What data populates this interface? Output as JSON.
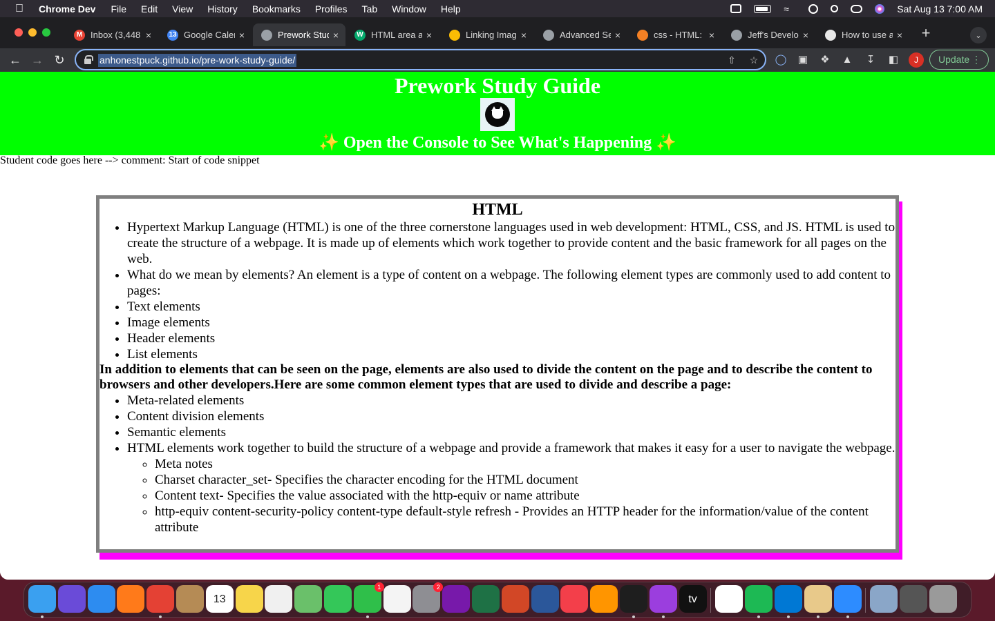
{
  "menubar": {
    "app_name": "Chrome Dev",
    "items": [
      "File",
      "Edit",
      "View",
      "History",
      "Bookmarks",
      "Profiles",
      "Tab",
      "Window",
      "Help"
    ],
    "datetime": "Sat Aug 13  7:00 AM"
  },
  "tabs": [
    {
      "title": "Inbox (3,448",
      "favicon": "gmail-icon",
      "fav_char": "M",
      "fav_color": "#ea4335"
    },
    {
      "title": "Google Caler",
      "favicon": "calendar-icon",
      "fav_char": "13",
      "fav_color": "#4285f4"
    },
    {
      "title": "Prework Stud",
      "favicon": "globe-icon",
      "fav_char": "",
      "fav_color": "#9aa0a6",
      "active": true
    },
    {
      "title": "HTML area a",
      "favicon": "w3-icon",
      "fav_char": "W",
      "fav_color": "#04aa6d"
    },
    {
      "title": "Linking Imag",
      "favicon": "drive-icon",
      "fav_char": "",
      "fav_color": "#fbbc04"
    },
    {
      "title": "Advanced Se",
      "favicon": "globe-icon",
      "fav_char": "",
      "fav_color": "#9aa0a6"
    },
    {
      "title": "css - HTML:",
      "favicon": "stackoverflow-icon",
      "fav_char": "",
      "fav_color": "#f48024"
    },
    {
      "title": "Jeff's Develo",
      "favicon": "globe-icon",
      "fav_char": "",
      "fav_color": "#9aa0a6"
    },
    {
      "title": "How to use a",
      "favicon": "openai-icon",
      "fav_char": "",
      "fav_color": "#e8e8e8"
    }
  ],
  "toolbar": {
    "url": "anhonestpuck.github.io/pre-work-study-guide/",
    "profile_initial": "J",
    "update_label": "Update"
  },
  "page": {
    "title": "Prework Study Guide",
    "subtitle": "✨ Open the Console to See What's Happening ✨",
    "comment_line": "Student code goes here --> comment: Start of code snippet",
    "card": {
      "heading": "HTML",
      "list1": [
        "Hypertext Markup Language (HTML) is one of the three cornerstone languages used in web development: HTML, CSS, and JS. HTML is used to create the structure of a webpage. It is made up of elements which work together to provide content and the basic framework for all pages on the web.",
        "What do we mean by elements? An element is a type of content on a webpage. The following element types are commonly used to add content to pages:",
        "Text elements",
        "Image elements",
        "Header elements",
        "List elements"
      ],
      "bold_paragraph": "In addition to elements that can be seen on the page, elements are also used to divide the content on the page and to describe the content to browsers and other developers.Here are some common element types that are used to divide and describe a page:",
      "list2": [
        "Meta-related elements",
        "Content division elements",
        "Semantic elements",
        "HTML elements work together to build the structure of a webpage and provide a framework that makes it easy for a user to navigate the webpage."
      ],
      "sublist": [
        "Meta notes",
        "Charset character_set- Specifies the character encoding for the HTML document",
        "Content text- Specifies the value associated with the http-equiv or name attribute",
        "http-equiv content-security-policy content-type default-style refresh - Provides an HTTP header for the information/value of the content attribute"
      ]
    }
  },
  "dock": {
    "apps": [
      {
        "name": "finder-icon",
        "color": "#3aa0f0"
      },
      {
        "name": "siri-icon",
        "color": "#6a4bd8"
      },
      {
        "name": "safari-icon",
        "color": "#2d8cf0"
      },
      {
        "name": "firefox-icon",
        "color": "#ff7a1a"
      },
      {
        "name": "chrome-icon",
        "color": "#e44134"
      },
      {
        "name": "contacts-icon",
        "color": "#b58b55"
      },
      {
        "name": "calendar-icon",
        "color": "#ffffff",
        "label": "13"
      },
      {
        "name": "notes-icon",
        "color": "#f7d54a"
      },
      {
        "name": "photos-icon",
        "color": "#f0f0f0"
      },
      {
        "name": "maps-icon",
        "color": "#6ac06a"
      },
      {
        "name": "messages-icon",
        "color": "#34c759"
      },
      {
        "name": "facetime-icon",
        "color": "#2fbf4a",
        "badge": "1"
      },
      {
        "name": "numbers-icon",
        "color": "#f4f4f4"
      },
      {
        "name": "system-preferences-icon",
        "color": "#8e8e93",
        "badge": "2"
      },
      {
        "name": "onenote-icon",
        "color": "#7719aa"
      },
      {
        "name": "excel-icon",
        "color": "#1e7145"
      },
      {
        "name": "powerpoint-icon",
        "color": "#d24726"
      },
      {
        "name": "word-icon",
        "color": "#2b579a"
      },
      {
        "name": "news-icon",
        "color": "#f33f4a"
      },
      {
        "name": "books-icon",
        "color": "#ff9500"
      },
      {
        "name": "terminal-icon",
        "color": "#1e1e1e"
      },
      {
        "name": "podcasts-icon",
        "color": "#9b3ede"
      },
      {
        "name": "appletv-icon",
        "color": "#111111",
        "label": "tv"
      },
      {
        "name": "slack-icon",
        "color": "#ffffff"
      },
      {
        "name": "spotify-icon",
        "color": "#1db954"
      },
      {
        "name": "vscode-icon",
        "color": "#0078d4"
      },
      {
        "name": "archive-utility-icon",
        "color": "#e8c98a"
      },
      {
        "name": "zoom-icon",
        "color": "#2d8cff"
      },
      {
        "name": "preview-icon",
        "color": "#8aa6c8"
      },
      {
        "name": "screen-recording-icon",
        "color": "#555555"
      },
      {
        "name": "trash-icon",
        "color": "#9a9a9a"
      }
    ]
  }
}
